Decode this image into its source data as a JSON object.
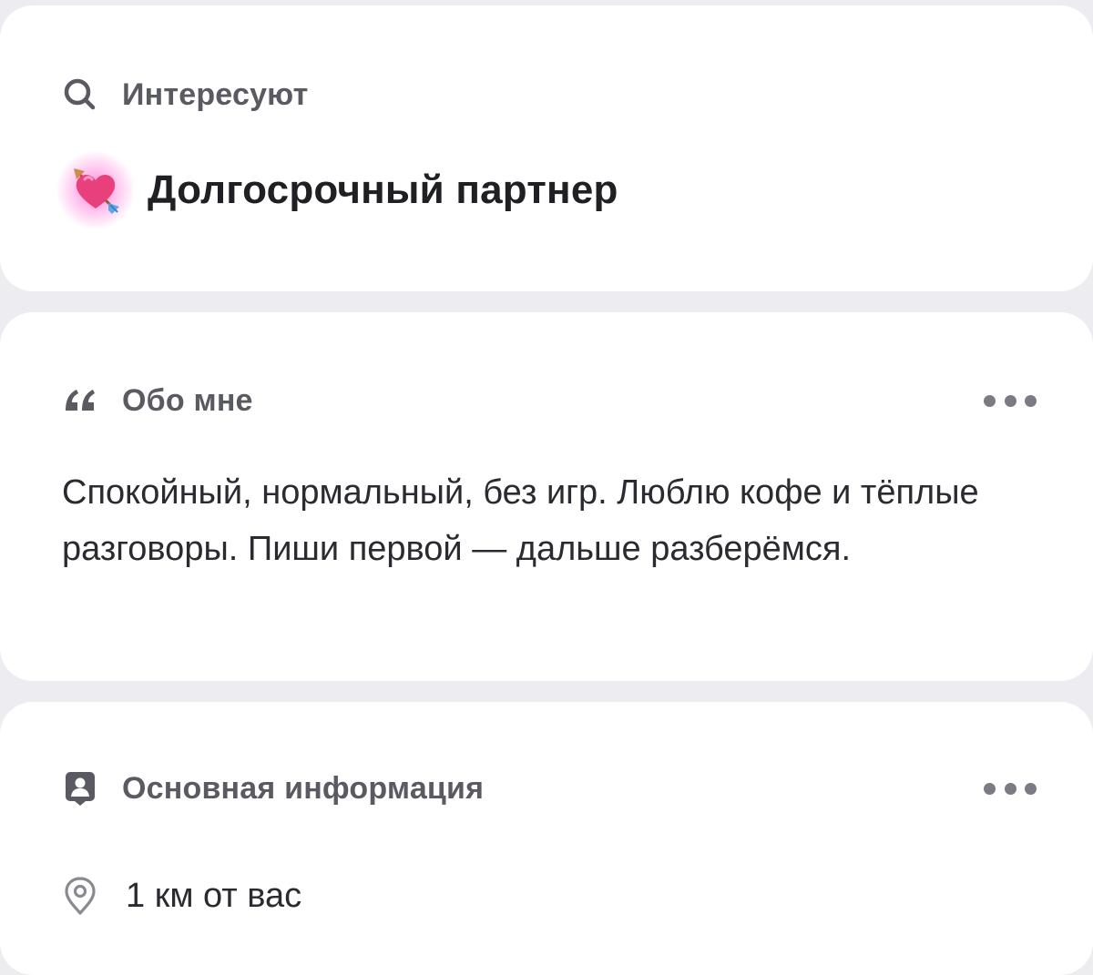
{
  "interests": {
    "header_icon": "search-icon",
    "title": "Интересуют",
    "item": {
      "icon": "heart-with-arrow-emoji",
      "label": "Долгосрочный партнер"
    }
  },
  "about": {
    "header_icon": "quote-icon",
    "title": "Обо мне",
    "more_icon": "more-dots-icon",
    "text": "Спокойный, нормальный, без игр. Люблю кофе и тёплые разговоры. Пиши первой — дальше разберёмся."
  },
  "basic_info": {
    "header_icon": "id-card-icon",
    "title": "Основная информация",
    "more_icon": "more-dots-icon",
    "location": {
      "icon": "location-pin-icon",
      "text": "1 км от вас"
    }
  },
  "colors": {
    "background": "#ededf1",
    "card": "#ffffff",
    "muted_text": "#5a5a62",
    "primary_text": "#1f1f24",
    "emoji_glow": "#ff5ac8"
  }
}
